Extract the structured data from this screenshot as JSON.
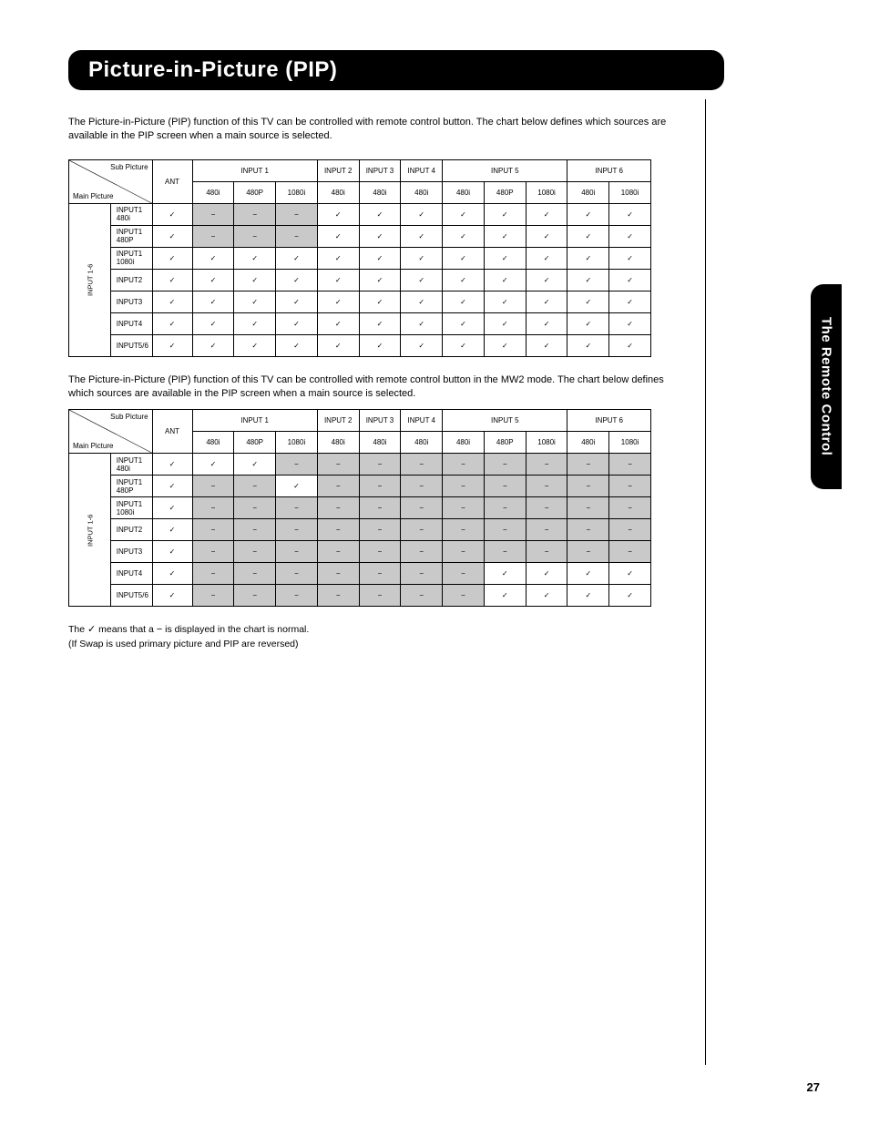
{
  "title": "Picture-in-Picture (PIP)",
  "side_tab": "The Remote Control",
  "intro": "The Picture-in-Picture (PIP) function of this TV can be controlled with remote control button. The chart below defines which sources are available in the PIP screen when a main source is selected.",
  "table2_caption": "The Picture-in-Picture (PIP) function of this TV can be controlled with remote control button in the MW2 mode. The chart below defines which sources are available in the PIP screen when a main source is selected.",
  "footnote_line1_prefix": "The ",
  "footnote_line1_mid": " means that a ",
  "footnote_line1_end": " is displayed in the chart is normal.",
  "footnote_line2": "(If Swap is used primary picture and PIP are reversed)",
  "check": "✓",
  "dash": "−",
  "colgroups": [
    "ANT",
    "INPUT 1",
    "INPUT 2",
    "INPUT 3",
    "INPUT 4",
    "INPUT 5",
    "INPUT 6"
  ],
  "subcols": [
    "480i",
    "480P",
    "1080i",
    "480i",
    "480i",
    "480i",
    "480i",
    "480P",
    "1080i",
    "480i",
    "1080i"
  ],
  "diag_sub": "Sub Picture",
  "diag_main": "Main Picture",
  "rows_group": "INPUT 1-6",
  "rows": [
    {
      "label": "INPUT1 480i",
      "cells": [
        "✓",
        "−",
        "−",
        "−",
        "✓",
        "✓",
        "✓",
        "✓",
        "✓",
        "✓",
        "✓",
        "✓"
      ]
    },
    {
      "label": "INPUT1 480P",
      "cells": [
        "✓",
        "−",
        "−",
        "−",
        "✓",
        "✓",
        "✓",
        "✓",
        "✓",
        "✓",
        "✓",
        "✓"
      ]
    },
    {
      "label": "INPUT1 1080i",
      "cells": [
        "✓",
        "✓",
        "✓",
        "✓",
        "✓",
        "✓",
        "✓",
        "✓",
        "✓",
        "✓",
        "✓",
        "✓"
      ]
    },
    {
      "label": "INPUT2",
      "cells": [
        "✓",
        "✓",
        "✓",
        "✓",
        "✓",
        "✓",
        "✓",
        "✓",
        "✓",
        "✓",
        "✓",
        "✓"
      ]
    },
    {
      "label": "INPUT3",
      "cells": [
        "✓",
        "✓",
        "✓",
        "✓",
        "✓",
        "✓",
        "✓",
        "✓",
        "✓",
        "✓",
        "✓",
        "✓"
      ]
    },
    {
      "label": "INPUT4",
      "cells": [
        "✓",
        "✓",
        "✓",
        "✓",
        "✓",
        "✓",
        "✓",
        "✓",
        "✓",
        "✓",
        "✓",
        "✓"
      ]
    },
    {
      "label": "INPUT5/6",
      "cells": [
        "✓",
        "✓",
        "✓",
        "✓",
        "✓",
        "✓",
        "✓",
        "✓",
        "✓",
        "✓",
        "✓",
        "✓"
      ]
    }
  ],
  "rows2": [
    {
      "label": "INPUT1 480i",
      "shade": [
        "",
        "",
        "",
        "s",
        "s",
        "s",
        "s",
        "s",
        "s",
        "s",
        "s",
        "s"
      ],
      "cells": [
        "✓",
        "✓",
        "✓",
        "−",
        "−",
        "−",
        "−",
        "−",
        "−",
        "−",
        "−",
        "−"
      ]
    },
    {
      "label": "INPUT1 480P",
      "shade": [
        "",
        "s",
        "s",
        "",
        "s",
        "s",
        "s",
        "s",
        "s",
        "s",
        "s",
        "s"
      ],
      "cells": [
        "✓",
        "−",
        "−",
        "✓",
        "−",
        "−",
        "−",
        "−",
        "−",
        "−",
        "−",
        "−"
      ]
    },
    {
      "label": "INPUT1 1080i",
      "shade": [
        "",
        "s",
        "s",
        "s",
        "s",
        "s",
        "s",
        "s",
        "s",
        "s",
        "s",
        "s"
      ],
      "cells": [
        "✓",
        "−",
        "−",
        "−",
        "−",
        "−",
        "−",
        "−",
        "−",
        "−",
        "−",
        "−"
      ]
    },
    {
      "label": "INPUT2",
      "shade": [
        "",
        "s",
        "s",
        "s",
        "s",
        "s",
        "s",
        "s",
        "s",
        "s",
        "s",
        "s"
      ],
      "cells": [
        "✓",
        "−",
        "−",
        "−",
        "−",
        "−",
        "−",
        "−",
        "−",
        "−",
        "−",
        "−"
      ]
    },
    {
      "label": "INPUT3",
      "shade": [
        "",
        "s",
        "s",
        "s",
        "s",
        "s",
        "s",
        "s",
        "s",
        "s",
        "s",
        "s"
      ],
      "cells": [
        "✓",
        "−",
        "−",
        "−",
        "−",
        "−",
        "−",
        "−",
        "−",
        "−",
        "−",
        "−"
      ]
    },
    {
      "label": "INPUT4",
      "shade": [
        "",
        "s",
        "s",
        "s",
        "s",
        "s",
        "s",
        "s",
        "",
        "",
        "",
        ""
      ],
      "cells": [
        "✓",
        "−",
        "−",
        "−",
        "−",
        "−",
        "−",
        "−",
        "✓",
        "✓",
        "✓",
        "✓"
      ]
    },
    {
      "label": "INPUT5/6",
      "shade": [
        "",
        "s",
        "s",
        "s",
        "s",
        "s",
        "s",
        "s",
        "",
        "",
        "",
        ""
      ],
      "cells": [
        "✓",
        "−",
        "−",
        "−",
        "−",
        "−",
        "−",
        "−",
        "✓",
        "✓",
        "✓",
        "✓"
      ]
    }
  ],
  "page_num": "27"
}
